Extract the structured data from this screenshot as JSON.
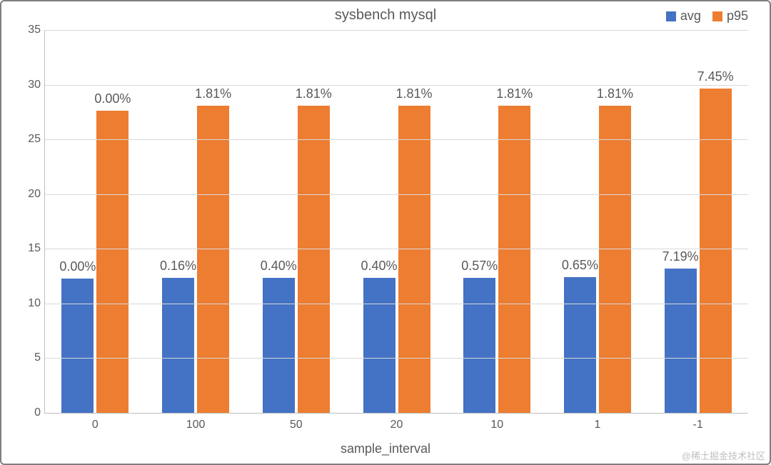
{
  "chart_data": {
    "type": "bar",
    "title": "sysbench  mysql",
    "xlabel": "sample_interval",
    "ylabel": "",
    "ylim": [
      0,
      35
    ],
    "yticks": [
      0,
      5,
      10,
      15,
      20,
      25,
      30,
      35
    ],
    "categories": [
      "0",
      "100",
      "50",
      "20",
      "10",
      "1",
      "-1"
    ],
    "series": [
      {
        "name": "avg",
        "color": "#4472C4",
        "values": [
          12.3,
          12.32,
          12.35,
          12.35,
          12.37,
          12.38,
          13.18
        ],
        "labels": [
          "0.00%",
          "0.16%",
          "0.40%",
          "0.40%",
          "0.57%",
          "0.65%",
          "7.19%"
        ]
      },
      {
        "name": "p95",
        "color": "#ED7D31",
        "values": [
          27.6,
          28.1,
          28.1,
          28.1,
          28.1,
          28.1,
          29.66
        ],
        "labels": [
          "0.00%",
          "1.81%",
          "1.81%",
          "1.81%",
          "1.81%",
          "1.81%",
          "7.45%"
        ]
      }
    ],
    "legend_position": "top-right"
  },
  "watermark": "@稀土掘金技术社区"
}
